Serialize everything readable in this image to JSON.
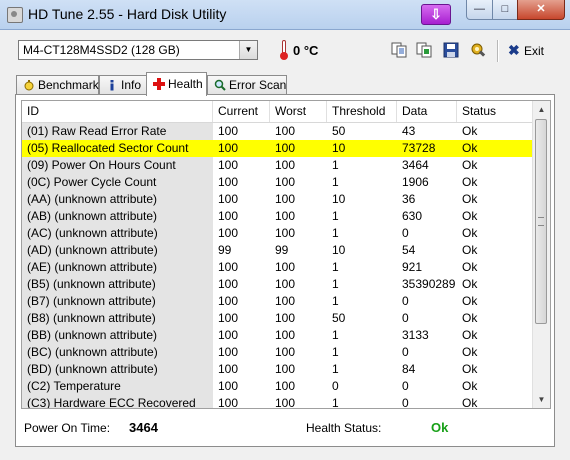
{
  "window": {
    "title": "HD Tune 2.55 - Hard Disk Utility"
  },
  "colors": {
    "highlight": "#ffff00",
    "ok_green": "#18a018"
  },
  "toolbar": {
    "drive": "M4-CT128M4SSD2 (128 GB)",
    "temperature": "0 °C",
    "exit_label": "Exit"
  },
  "tabs": [
    {
      "label": "Benchmark",
      "icon": "stopwatch-icon"
    },
    {
      "label": "Info",
      "icon": "info-icon"
    },
    {
      "label": "Health",
      "icon": "health-cross-icon",
      "active": true
    },
    {
      "label": "Error Scan",
      "icon": "magnifier-icon"
    }
  ],
  "table": {
    "columns": [
      "ID",
      "Current",
      "Worst",
      "Threshold",
      "Data",
      "Status"
    ],
    "rows": [
      {
        "id": "(01) Raw Read Error Rate",
        "current": "100",
        "worst": "100",
        "threshold": "50",
        "data": "43",
        "status": "Ok"
      },
      {
        "id": "(05) Reallocated Sector Count",
        "current": "100",
        "worst": "100",
        "threshold": "10",
        "data": "73728",
        "status": "Ok",
        "highlighted": true
      },
      {
        "id": "(09) Power On Hours Count",
        "current": "100",
        "worst": "100",
        "threshold": "1",
        "data": "3464",
        "status": "Ok"
      },
      {
        "id": "(0C) Power Cycle Count",
        "current": "100",
        "worst": "100",
        "threshold": "1",
        "data": "1906",
        "status": "Ok"
      },
      {
        "id": "(AA) (unknown attribute)",
        "current": "100",
        "worst": "100",
        "threshold": "10",
        "data": "36",
        "status": "Ok"
      },
      {
        "id": "(AB) (unknown attribute)",
        "current": "100",
        "worst": "100",
        "threshold": "1",
        "data": "630",
        "status": "Ok"
      },
      {
        "id": "(AC) (unknown attribute)",
        "current": "100",
        "worst": "100",
        "threshold": "1",
        "data": "0",
        "status": "Ok"
      },
      {
        "id": "(AD) (unknown attribute)",
        "current": "99",
        "worst": "99",
        "threshold": "10",
        "data": "54",
        "status": "Ok"
      },
      {
        "id": "(AE) (unknown attribute)",
        "current": "100",
        "worst": "100",
        "threshold": "1",
        "data": "921",
        "status": "Ok"
      },
      {
        "id": "(B5) (unknown attribute)",
        "current": "100",
        "worst": "100",
        "threshold": "1",
        "data": "35390289",
        "status": "Ok"
      },
      {
        "id": "(B7) (unknown attribute)",
        "current": "100",
        "worst": "100",
        "threshold": "1",
        "data": "0",
        "status": "Ok"
      },
      {
        "id": "(B8) (unknown attribute)",
        "current": "100",
        "worst": "100",
        "threshold": "50",
        "data": "0",
        "status": "Ok"
      },
      {
        "id": "(BB) (unknown attribute)",
        "current": "100",
        "worst": "100",
        "threshold": "1",
        "data": "3133",
        "status": "Ok"
      },
      {
        "id": "(BC) (unknown attribute)",
        "current": "100",
        "worst": "100",
        "threshold": "1",
        "data": "0",
        "status": "Ok"
      },
      {
        "id": "(BD) (unknown attribute)",
        "current": "100",
        "worst": "100",
        "threshold": "1",
        "data": "84",
        "status": "Ok"
      },
      {
        "id": "(C2) Temperature",
        "current": "100",
        "worst": "100",
        "threshold": "0",
        "data": "0",
        "status": "Ok"
      },
      {
        "id": "(C3) Hardware ECC Recovered",
        "current": "100",
        "worst": "100",
        "threshold": "1",
        "data": "0",
        "status": "Ok"
      }
    ]
  },
  "footer": {
    "power_on_label": "Power On Time:",
    "power_on_value": "3464",
    "health_label": "Health Status:",
    "health_value": "Ok"
  }
}
